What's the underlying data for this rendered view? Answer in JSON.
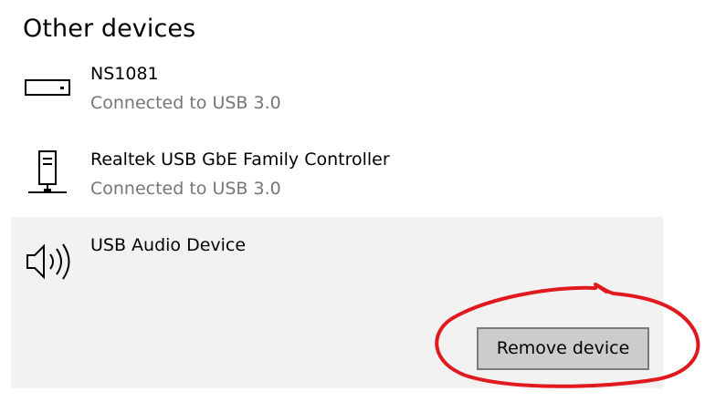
{
  "section": {
    "title": "Other devices"
  },
  "devices": [
    {
      "name": "NS1081",
      "status": "Connected to USB 3.0",
      "icon": "drive-icon"
    },
    {
      "name": "Realtek USB GbE Family Controller",
      "status": "Connected to USB 3.0",
      "icon": "network-adapter-icon"
    },
    {
      "name": "USB Audio Device",
      "status": "",
      "icon": "speaker-icon",
      "selected": true
    }
  ],
  "actions": {
    "remove_label": "Remove device"
  },
  "colors": {
    "selected_background": "#f2f2f2",
    "status_text": "#767676",
    "button_background": "#cccccc",
    "annotation": "#e0191f"
  }
}
